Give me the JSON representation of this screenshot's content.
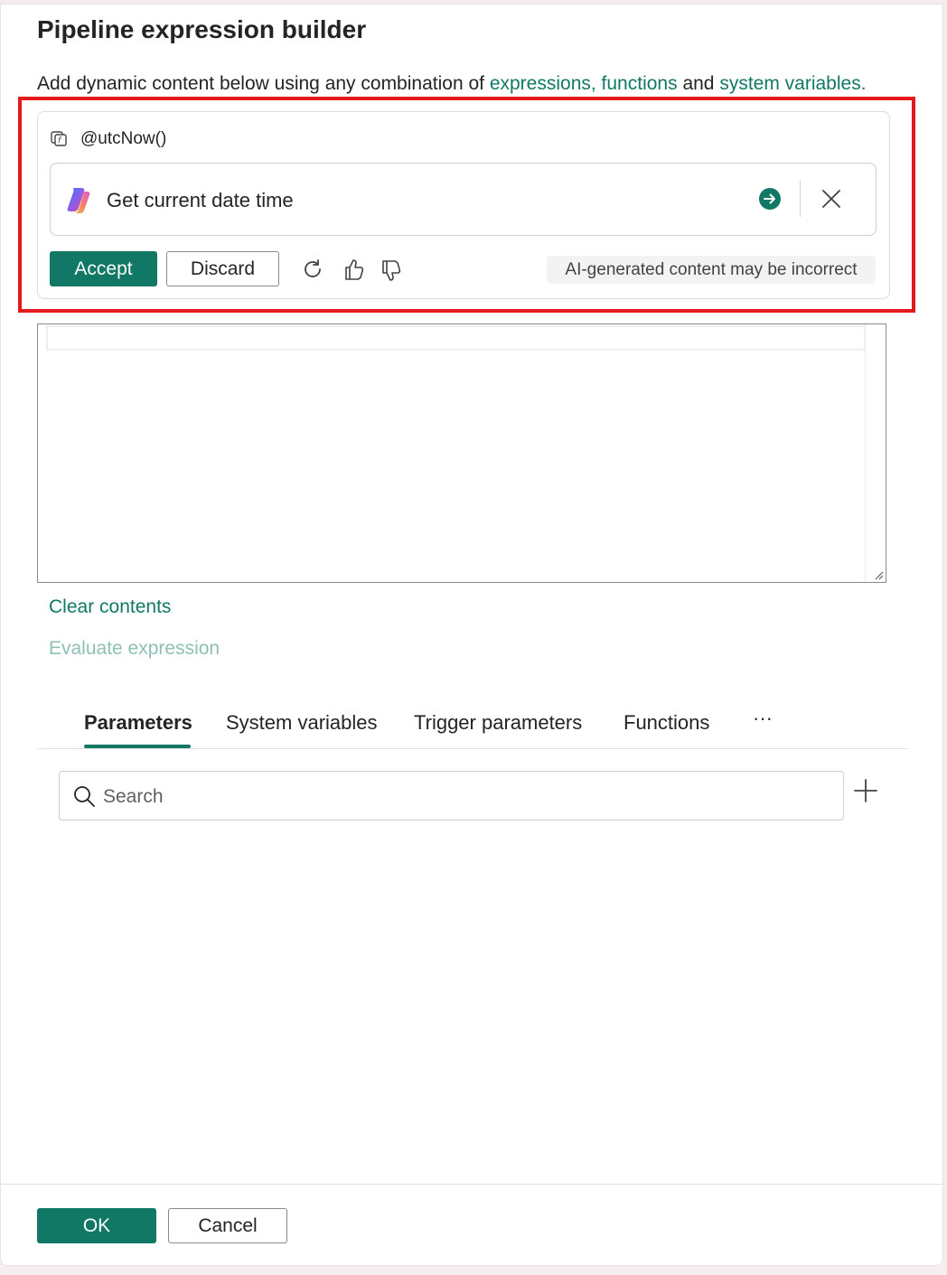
{
  "dialog": {
    "title": "Pipeline expression builder",
    "description": {
      "prefix": "Add dynamic content below using any combination of ",
      "link_expressions": "expressions,",
      "link_functions": "functions",
      "and_text": " and ",
      "link_system_variables": "system variables."
    }
  },
  "copilot": {
    "expression": "@utcNow()",
    "prompt": "Get current date time",
    "accept_label": "Accept",
    "discard_label": "Discard",
    "disclaimer": "AI-generated content may be incorrect",
    "icons": [
      "function-icon",
      "copilot-logo-icon",
      "send-arrow-icon",
      "close-icon",
      "refresh-icon",
      "thumbs-up-icon",
      "thumbs-down-icon"
    ]
  },
  "editor": {
    "content": "",
    "clear_label": "Clear contents",
    "evaluate_label": "Evaluate expression"
  },
  "tabs": [
    {
      "label": "Parameters",
      "active": true
    },
    {
      "label": "System variables",
      "active": false
    },
    {
      "label": "Trigger parameters",
      "active": false
    },
    {
      "label": "Functions",
      "active": false
    }
  ],
  "tabs_more": "···",
  "search": {
    "placeholder": "Search",
    "value": ""
  },
  "footer": {
    "ok_label": "OK",
    "cancel_label": "Cancel"
  },
  "colors": {
    "accent": "#117865",
    "highlight": "#e3191c",
    "disabled_link": "#8fbfb5"
  }
}
